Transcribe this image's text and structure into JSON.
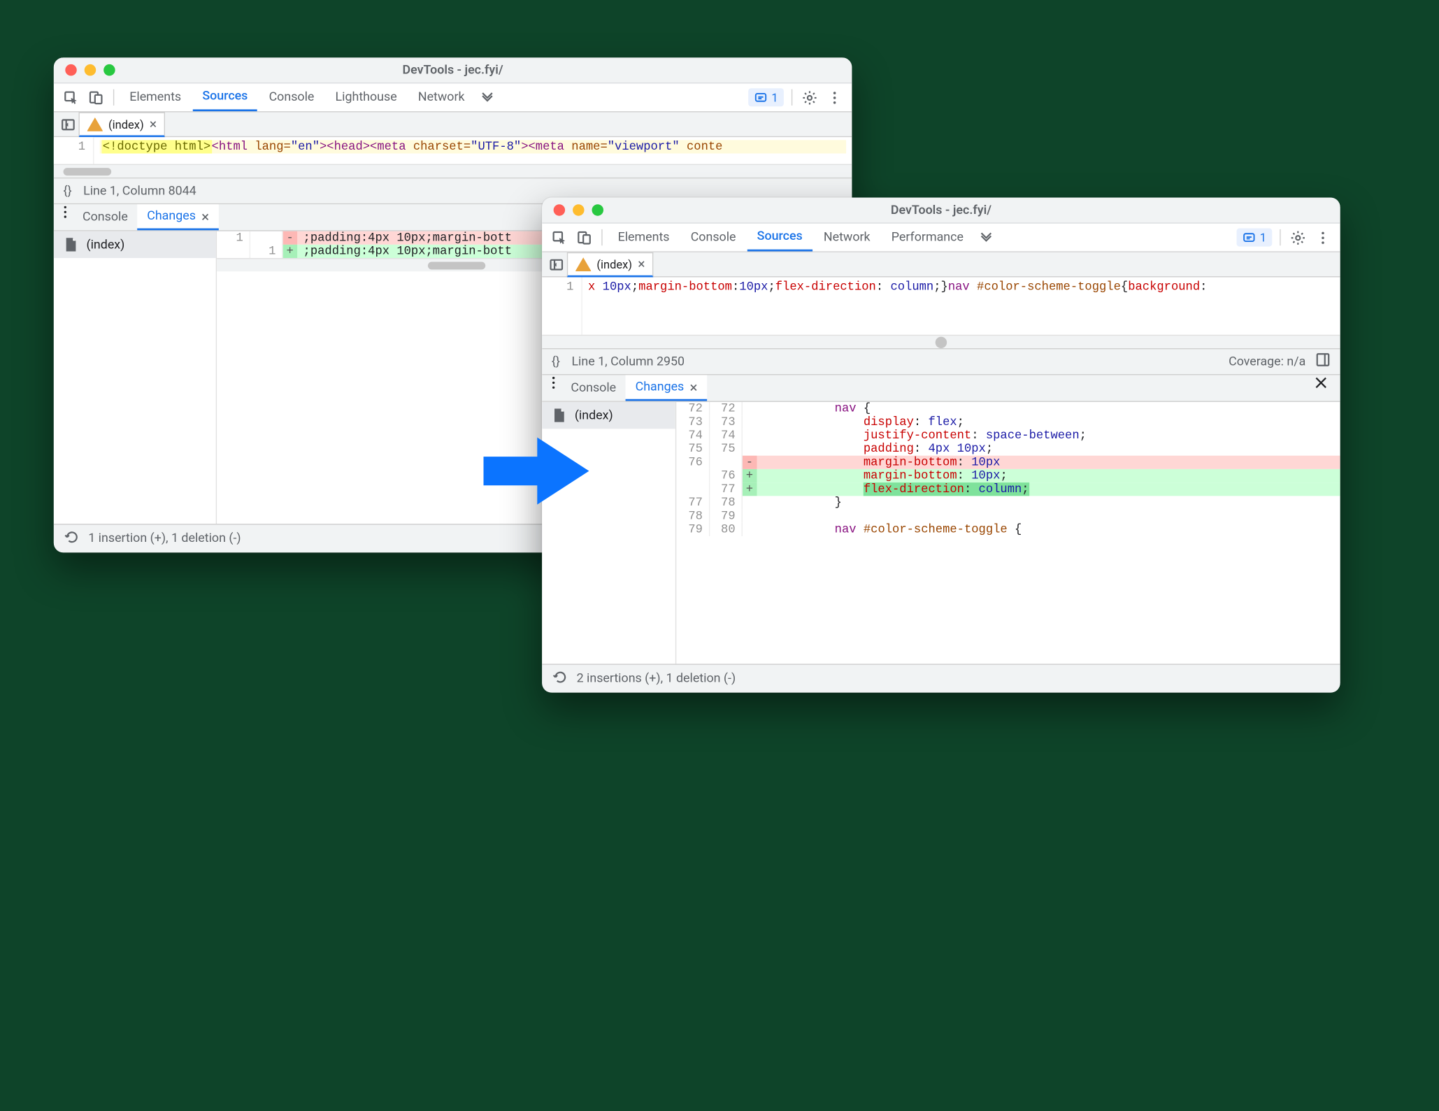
{
  "windows": {
    "a": {
      "title": "DevTools - jec.fyi/",
      "tabs": [
        "Elements",
        "Sources",
        "Console",
        "Lighthouse",
        "Network"
      ],
      "active_tab_index": 1
    },
    "b": {
      "title": "DevTools - jec.fyi/",
      "tabs": [
        "Elements",
        "Console",
        "Sources",
        "Network",
        "Performance"
      ],
      "active_tab_index": 2
    }
  },
  "issues_chip": {
    "count": "1"
  },
  "file_tab_label": "(index)",
  "editor_a": {
    "lineno": "1",
    "code_html": "<span class='tok-doctype'>&lt;!doctype&nbsp;html&gt;</span><span class='tok-tag'>&lt;html</span> <span class='tok-attr'>lang=</span><span class='tok-str'>\"en\"</span><span class='tok-tag'>&gt;&lt;head&gt;&lt;meta</span> <span class='tok-attr'>charset=</span><span class='tok-str'>\"UTF-8\"</span><span class='tok-tag'>&gt;&lt;meta</span> <span class='tok-attr'>name=</span><span class='tok-str'>\"viewport\"</span> <span class='tok-attr'>conte</span>"
  },
  "editor_b": {
    "lineno": "1",
    "code_html": "<span class='tok-css-prop'>x</span> <span class='tok-css-val'>10px</span>;<span class='tok-css-prop'>margin-bottom</span>:<span class='tok-css-val'>10px</span>;<span class='tok-css-prop'>flex-direction</span>: <span class='tok-css-val'>column</span>;}<span class='tok-sel'>nav</span> <span class='tok-hash'>#color-scheme-toggle</span>{<span class='tok-css-prop'>background</span>:"
  },
  "status_a": {
    "braces": "{}",
    "pos": "Line 1, Column 8044"
  },
  "status_b": {
    "braces": "{}",
    "pos": "Line 1, Column 2950",
    "coverage": "Coverage: n/a"
  },
  "drawer": {
    "tabs": [
      "Console",
      "Changes"
    ],
    "active_index": 1,
    "file_list_item": "(index)"
  },
  "diff_a": {
    "rows": [
      {
        "l": "1",
        "r": "",
        "sign": "-",
        "kind": "del",
        "txt": ";padding:4px 10px;margin-bott"
      },
      {
        "l": "",
        "r": "1",
        "sign": "+",
        "kind": "add",
        "txt": ";padding:4px 10px;margin-bott"
      }
    ],
    "footer": "1 insertion (+), 1 deletion (-)"
  },
  "diff_b": {
    "rows": [
      {
        "l": "72",
        "r": "72",
        "sign": "",
        "kind": "ctx",
        "html": "<span class='tok-sel'>nav</span> {"
      },
      {
        "l": "73",
        "r": "73",
        "sign": "",
        "kind": "ctx",
        "html": "    <span class='tok-css-prop'>display</span>: <span class='tok-css-val'>flex</span>;"
      },
      {
        "l": "74",
        "r": "74",
        "sign": "",
        "kind": "ctx",
        "html": "    <span class='tok-css-prop'>justify-content</span>: <span class='tok-css-val'>space-between</span>;"
      },
      {
        "l": "75",
        "r": "75",
        "sign": "",
        "kind": "ctx",
        "html": "    <span class='tok-css-prop'>padding</span>: <span class='tok-css-val'>4px 10px</span>;"
      },
      {
        "l": "76",
        "r": "",
        "sign": "-",
        "kind": "del",
        "html": "    <span class='tok-css-prop'>margin-bottom</span>: <span class='tok-css-val'>10px</span>"
      },
      {
        "l": "",
        "r": "76",
        "sign": "+",
        "kind": "add",
        "html": "    <span class='tok-css-prop'>margin-bottom</span>: <span class='tok-css-val'>10px</span><span class='ins'>;</span>"
      },
      {
        "l": "",
        "r": "77",
        "sign": "+",
        "kind": "add hi",
        "html": "    <span class='ins'><span class='tok-css-prop'>flex-direction</span>: <span class='tok-css-val'>column</span>;</span>"
      },
      {
        "l": "77",
        "r": "78",
        "sign": "",
        "kind": "ctx",
        "html": "}"
      },
      {
        "l": "78",
        "r": "79",
        "sign": "",
        "kind": "ctx",
        "html": ""
      },
      {
        "l": "79",
        "r": "80",
        "sign": "",
        "kind": "ctx",
        "html": "<span class='tok-sel'>nav</span> <span class='tok-hash'>#color-scheme-toggle</span> {"
      }
    ],
    "footer": "2 insertions (+), 1 deletion (-)"
  }
}
